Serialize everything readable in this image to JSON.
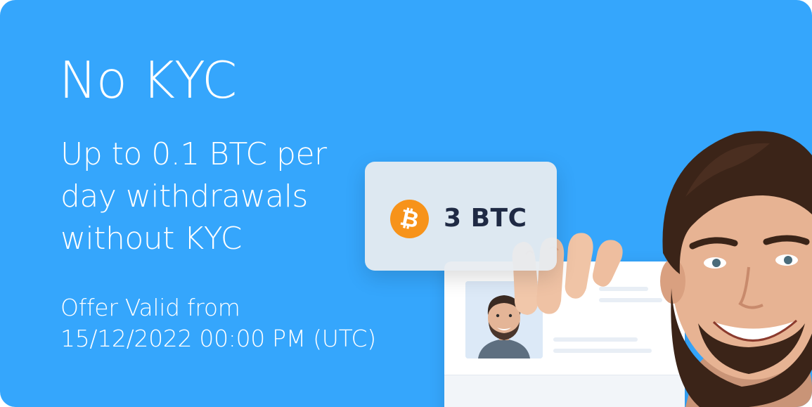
{
  "promo": {
    "title": "No KYC",
    "subtitle_lines": [
      "Up to 0.1 BTC per",
      "day withdrawals",
      "without KYC"
    ],
    "offer_lines": [
      "Offer Valid from",
      "15/12/2022 00:00 PM (UTC)"
    ]
  },
  "balance_card": {
    "amount": "3 BTC",
    "coin_icon": "bitcoin-icon"
  },
  "colors": {
    "background": "#35a6fc",
    "bitcoin_orange": "#f7931a",
    "amount_text": "#1f2a44"
  }
}
